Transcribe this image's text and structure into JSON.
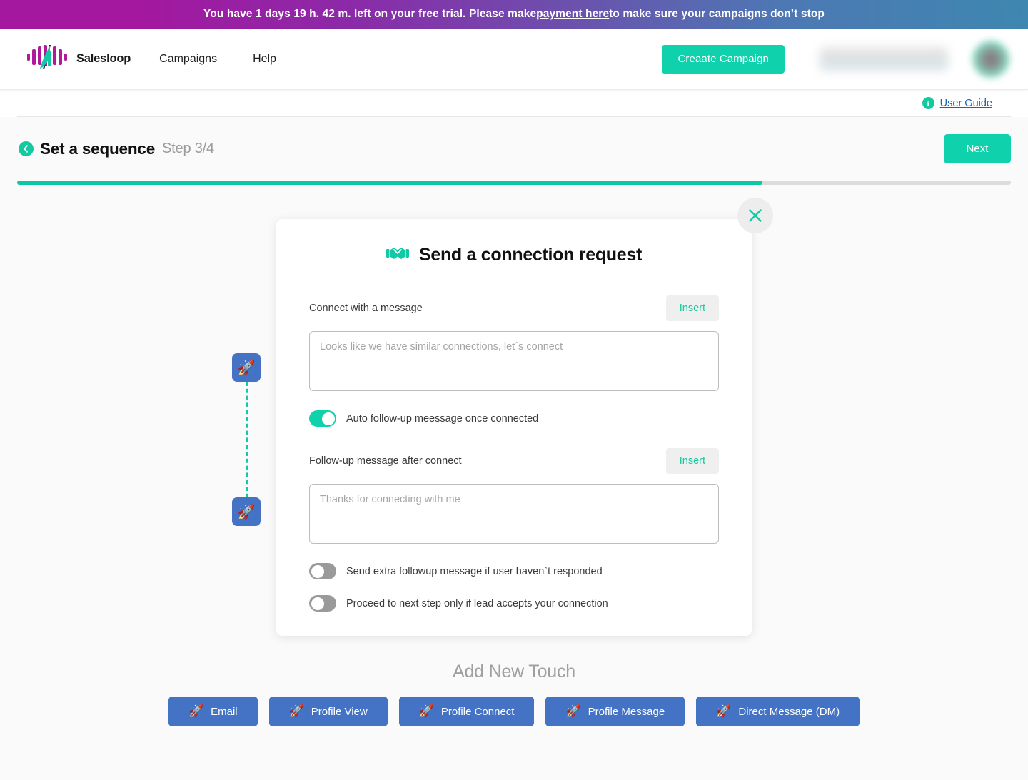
{
  "banner": {
    "text_before": "You have 1 days 19 h. 42 m. left on your free trial. Please make ",
    "link_text": "payment here",
    "text_after": " to make sure your campaigns don’t stop",
    "gradient_start": "#a3189f",
    "gradient_end": "#3e87b0"
  },
  "nav": {
    "brand_name": "Salesloop",
    "links": [
      {
        "label": "Campaigns"
      },
      {
        "label": "Help"
      }
    ],
    "create_campaign_label": "Creaate Campaign",
    "accent_color": "#0fd1ac"
  },
  "guide": {
    "label": "User Guide",
    "icon": "info-icon",
    "color": "#1565c0"
  },
  "step": {
    "title": "Set a sequence",
    "counter": "Step 3/4",
    "next_label": "Next",
    "progress_percent": 75,
    "progress_color": "#0bc9a4"
  },
  "modal": {
    "title": "Send a connection request",
    "title_icon": "handshake-icon",
    "close_icon": "close-icon",
    "connect_message": {
      "label": "Connect with a message",
      "insert_label": "Insert",
      "placeholder": "Looks like we have similar connections, let´s connect",
      "value": ""
    },
    "auto_followup_toggle": {
      "label": "Auto follow-up meessage once connected",
      "state": "on"
    },
    "followup_message": {
      "label": "Follow-up message after connect",
      "insert_label": "Insert",
      "placeholder": "Thanks for connecting with me",
      "value": ""
    },
    "extra_followup_toggle": {
      "label": "Send extra followup message if user haven`t responded",
      "state": "off"
    },
    "proceed_toggle": {
      "label": "Proceed to next step only if lead accepts your connection",
      "state": "off"
    }
  },
  "add_touch": {
    "title": "Add New Touch",
    "buttons": [
      {
        "label": "Email",
        "icon": "rocket-icon"
      },
      {
        "label": "Profile View",
        "icon": "rocket-icon"
      },
      {
        "label": "Profile Connect",
        "icon": "rocket-icon"
      },
      {
        "label": "Profile Message",
        "icon": "rocket-icon"
      },
      {
        "label": "Direct Message (DM)",
        "icon": "rocket-icon"
      }
    ],
    "button_color": "#4472c4"
  }
}
